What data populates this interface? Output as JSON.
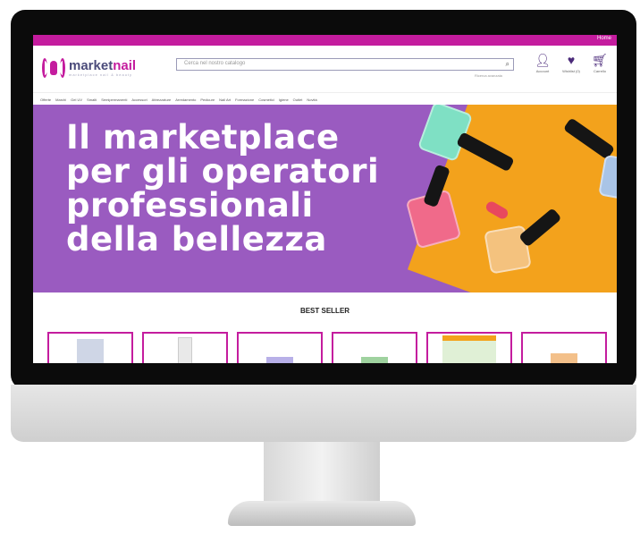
{
  "site": {
    "top_link": "Home",
    "logo": {
      "name_a": "market",
      "name_b": "nail",
      "tagline": "marketplace nail & beauty"
    },
    "search": {
      "placeholder": "Cerca nel nostro catalogo",
      "sub_label": "Ricerca avanzata"
    },
    "actions": [
      {
        "icon": "user-icon",
        "label": "Account"
      },
      {
        "icon": "heart-icon",
        "label": "Wishlist (0)"
      },
      {
        "icon": "cart-icon",
        "label": "Carrello"
      }
    ],
    "nav": [
      "Offerte",
      "Marchi",
      "Gel UV",
      "Smalti",
      "Semipermanenti",
      "Accessori",
      "Attrezzature",
      "Arredamento",
      "Pedicure",
      "Nail Art",
      "Formazione",
      "Cosmetici",
      "Igiene",
      "Outlet",
      "Novità"
    ],
    "hero": {
      "lines": [
        "Il marketplace",
        "per gli operatori",
        "professionali",
        "della bellezza"
      ]
    },
    "section_title": "BEST SELLER",
    "products_count_visible": 6
  },
  "colors": {
    "brand": "#c41c9e",
    "hero_bg": "#9a5bc0",
    "hero_accent": "#f3a21c",
    "logo_text": "#4b4b7a"
  }
}
